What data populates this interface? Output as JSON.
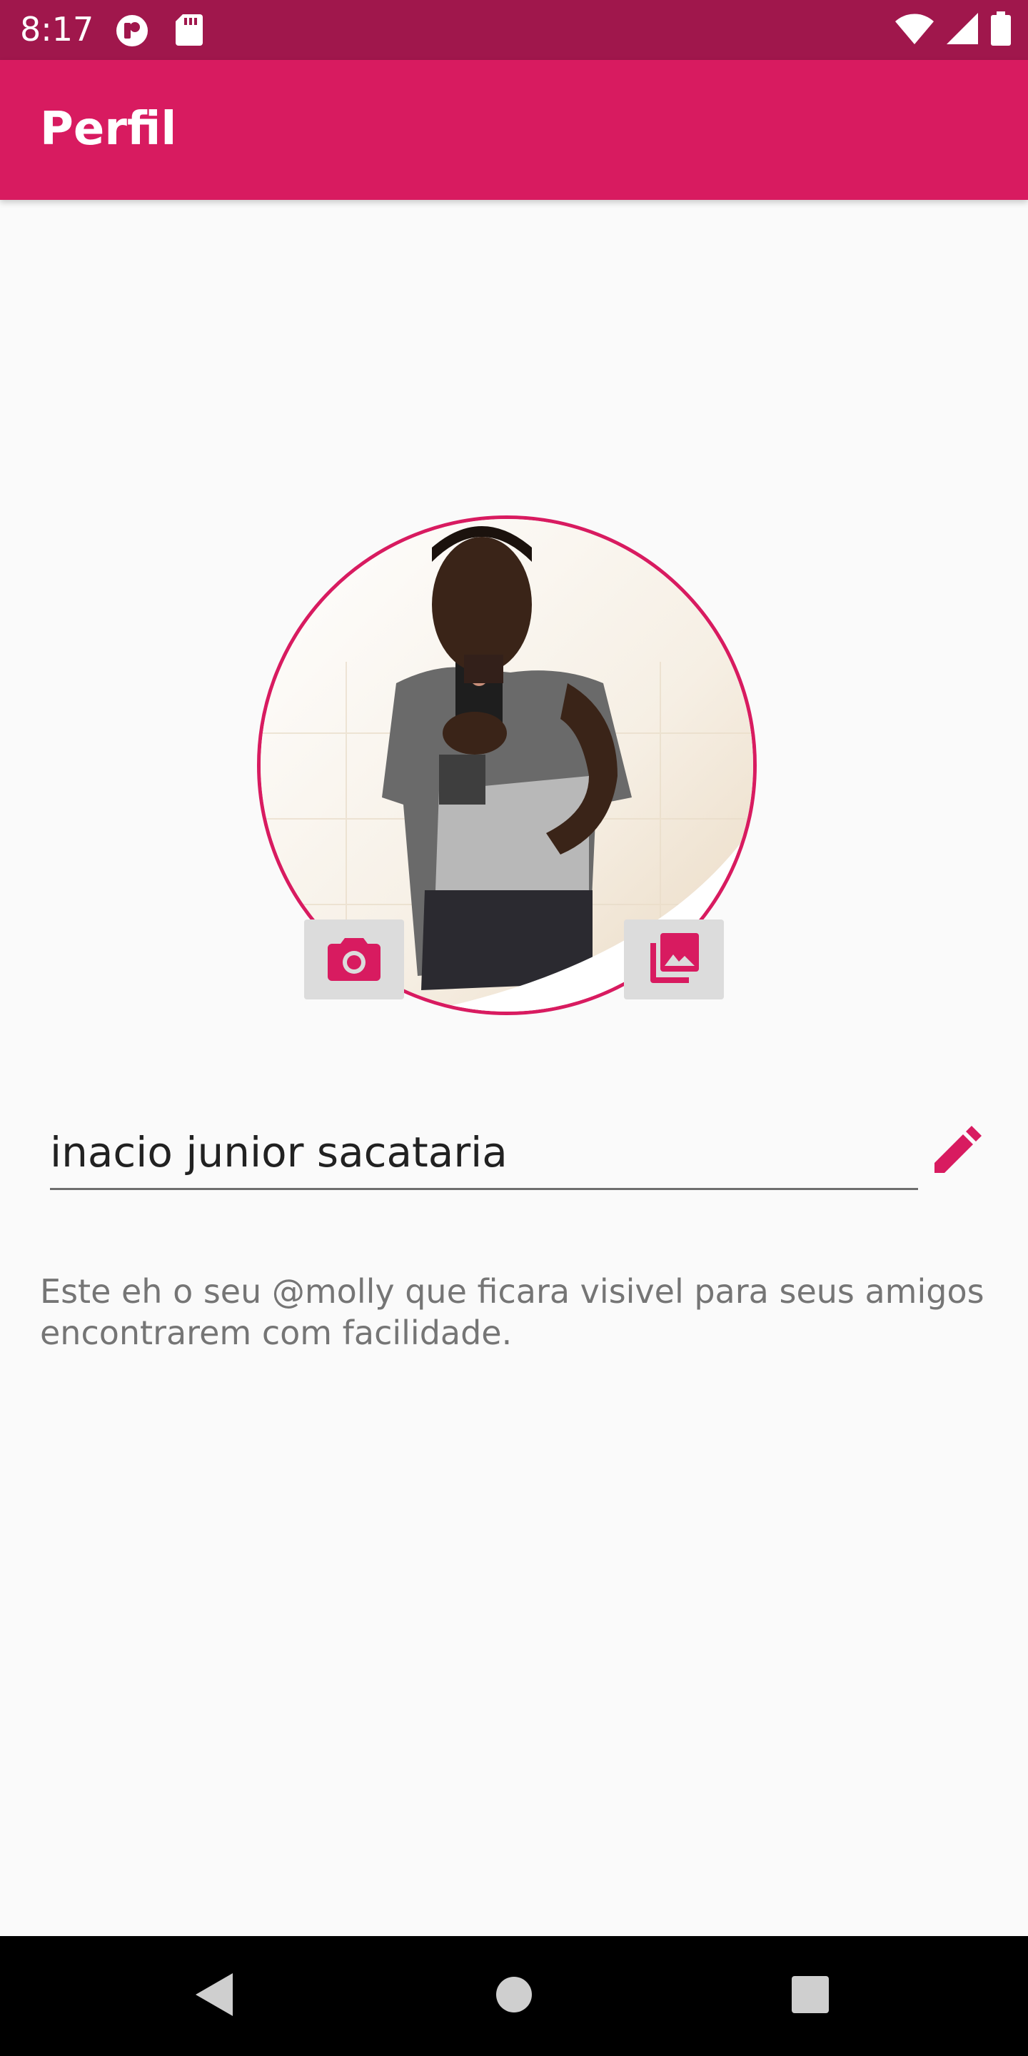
{
  "status_bar": {
    "time": "8:17",
    "icons": [
      "cast-icon",
      "sd-card-icon",
      "wifi-icon",
      "signal-icon",
      "battery-icon"
    ]
  },
  "app_bar": {
    "title": "Perfil",
    "background_color": "#d81b60"
  },
  "profile": {
    "avatar_alt": "profile-photo",
    "camera_button_icon": "camera-icon",
    "gallery_button_icon": "gallery-icon"
  },
  "name_field": {
    "value": "inacio junior sacataria",
    "edit_icon": "pencil-icon"
  },
  "hint_text": "Este eh o seu @molly que ficara visivel para seus amigos encontrarem com facilidade.",
  "nav_bar": {
    "buttons": [
      "back-icon",
      "home-icon",
      "recents-icon"
    ]
  },
  "colors": {
    "accent": "#d81b60",
    "status_bar": "#a0174c"
  }
}
